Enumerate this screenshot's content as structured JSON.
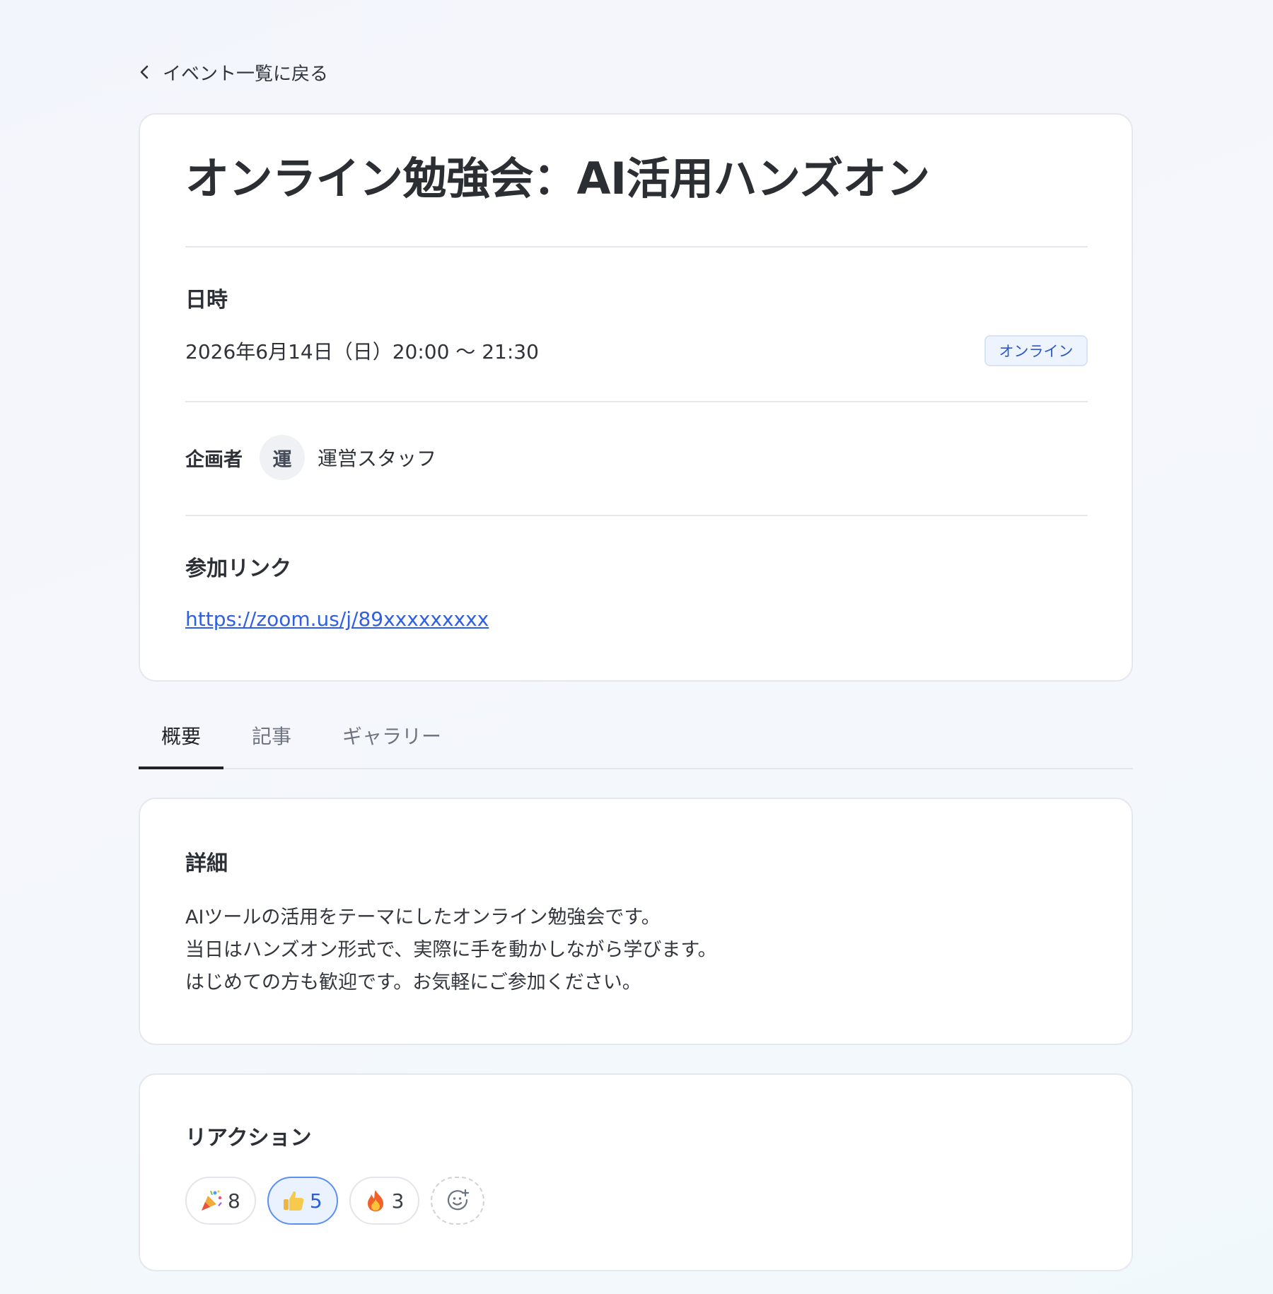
{
  "nav": {
    "back_label": "イベント一覧に戻る"
  },
  "event": {
    "title": "オンライン勉強会：AI活用ハンズオン",
    "datetime_label": "日時",
    "datetime": "2026年6月14日（日）20:00 〜 21:30",
    "format_badge": "オンライン",
    "organizer_label": "企画者",
    "organizer_avatar_initial": "運",
    "organizer_name": "運営スタッフ",
    "join_label": "参加リンク",
    "join_url": "https://zoom.us/j/89xxxxxxxxx"
  },
  "tabs": [
    {
      "label": "概要",
      "active": true
    },
    {
      "label": "記事",
      "active": false
    },
    {
      "label": "ギャラリー",
      "active": false
    }
  ],
  "detail": {
    "heading": "詳細",
    "lines": [
      "AIツールの活用をテーマにしたオンライン勉強会です。",
      "当日はハンズオン形式で、実際に手を動かしながら学びます。",
      "はじめての方も歓迎です。お気軽にご参加ください。"
    ]
  },
  "reactions": {
    "heading": "リアクション",
    "items": [
      {
        "icon": "party-popper-icon",
        "count": "8",
        "selected": false
      },
      {
        "icon": "thumbs-up-icon",
        "count": "5",
        "selected": true
      },
      {
        "icon": "fire-icon",
        "count": "3",
        "selected": false
      }
    ],
    "add_icon": "add-reaction-icon"
  },
  "colors": {
    "accent": "#2f5fe3",
    "badge_bg": "#eef4fd",
    "selected_chip_border": "#5b8ff0"
  }
}
